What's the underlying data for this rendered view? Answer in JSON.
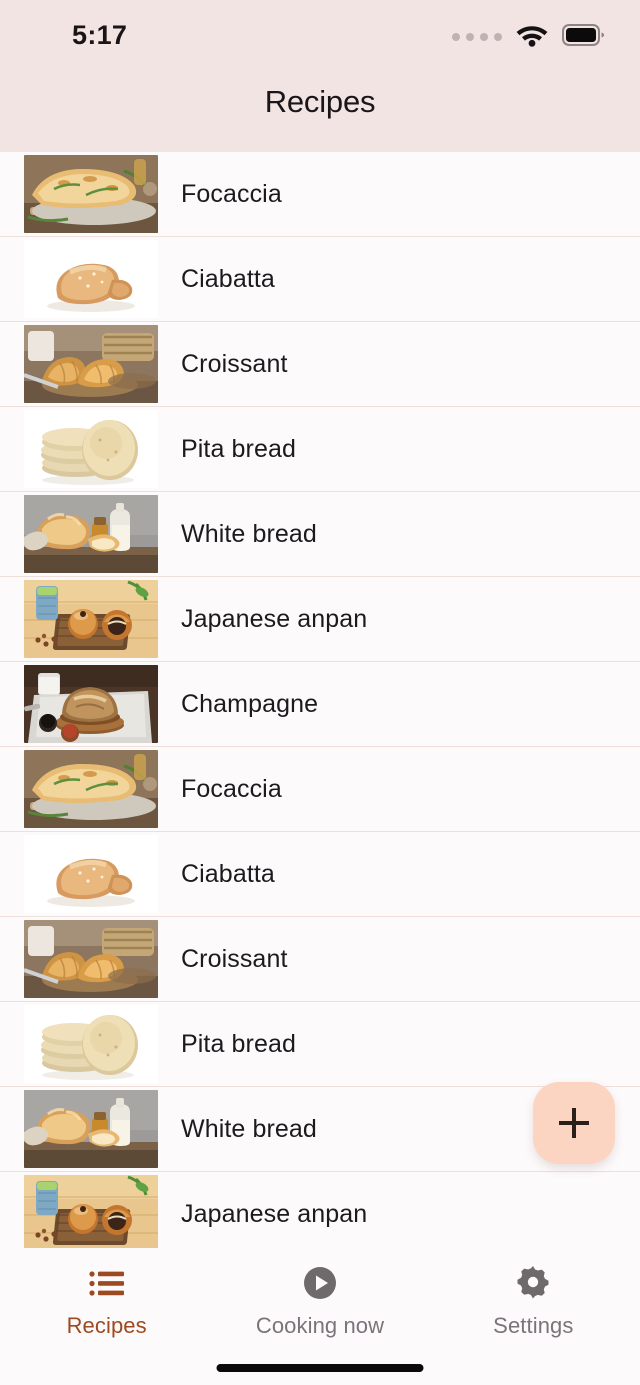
{
  "status_bar": {
    "time": "5:17",
    "signal_icon": "signal-dots-icon",
    "wifi_icon": "wifi-icon",
    "battery_icon": "battery-full-icon"
  },
  "header": {
    "title": "Recipes",
    "background_color": "#f2e4e3"
  },
  "list": {
    "rows": [
      {
        "label": "Focaccia",
        "thumb": "focaccia-thumb"
      },
      {
        "label": "Ciabatta",
        "thumb": "ciabatta-thumb"
      },
      {
        "label": "Croissant",
        "thumb": "croissant-thumb"
      },
      {
        "label": "Pita bread",
        "thumb": "pita-bread-thumb"
      },
      {
        "label": "White bread",
        "thumb": "white-bread-thumb"
      },
      {
        "label": "Japanese anpan",
        "thumb": "japanese-anpan-thumb"
      },
      {
        "label": "Champagne",
        "thumb": "champagne-thumb"
      },
      {
        "label": "Focaccia",
        "thumb": "focaccia-thumb"
      },
      {
        "label": "Ciabatta",
        "thumb": "ciabatta-thumb"
      },
      {
        "label": "Croissant",
        "thumb": "croissant-thumb"
      },
      {
        "label": "Pita bread",
        "thumb": "pita-bread-thumb"
      },
      {
        "label": "White bread",
        "thumb": "white-bread-thumb"
      },
      {
        "label": "Japanese anpan",
        "thumb": "japanese-anpan-thumb"
      }
    ]
  },
  "fab": {
    "icon": "plus-icon",
    "label": "+",
    "background_color": "#fbd4c2"
  },
  "tabbar": {
    "active_color": "#9d4a20",
    "inactive_color": "#78747a",
    "tabs": [
      {
        "label": "Recipes",
        "icon": "list-icon",
        "active": true
      },
      {
        "label": "Cooking now",
        "icon": "play-circle-icon",
        "active": false
      },
      {
        "label": "Settings",
        "icon": "gear-icon",
        "active": false
      }
    ]
  }
}
